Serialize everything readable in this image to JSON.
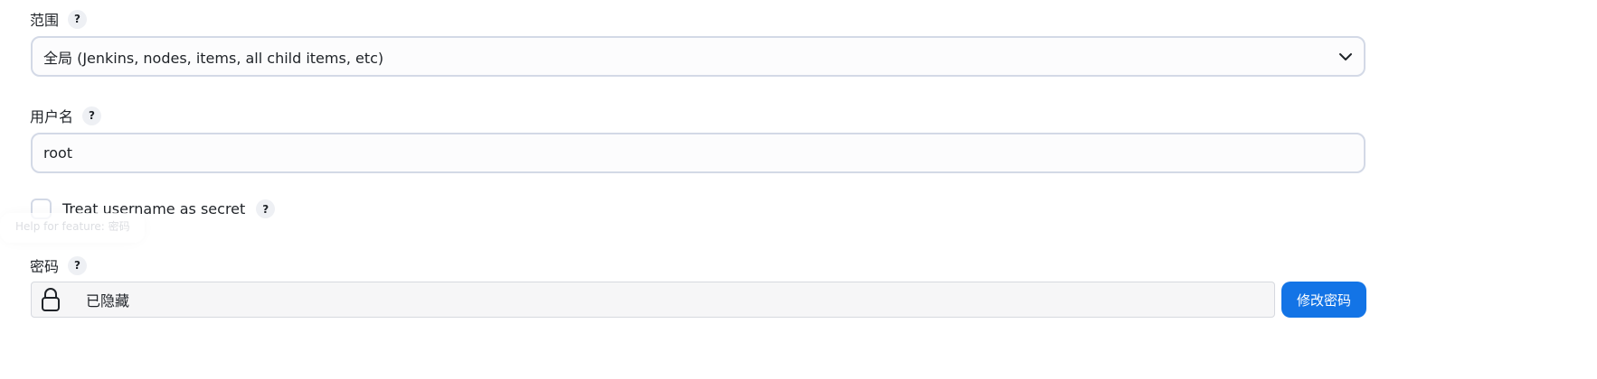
{
  "scope": {
    "label": "范围",
    "help": "?",
    "selected": "全局 (Jenkins, nodes, items, all child items, etc)"
  },
  "username": {
    "label": "用户名",
    "help": "?",
    "value": "root"
  },
  "treat_secret": {
    "label": "Treat username as secret",
    "help": "?",
    "checked": false
  },
  "tooltip": {
    "text": "Help for feature: 密码"
  },
  "password": {
    "label": "密码",
    "help": "?",
    "value": "已隐藏",
    "change_button": "修改密码"
  },
  "icons": {
    "select_chevron": "chevron-down-icon",
    "password_lock": "lock-icon"
  },
  "colors": {
    "accent": "#1374e6",
    "border": "#d3d9e6"
  }
}
